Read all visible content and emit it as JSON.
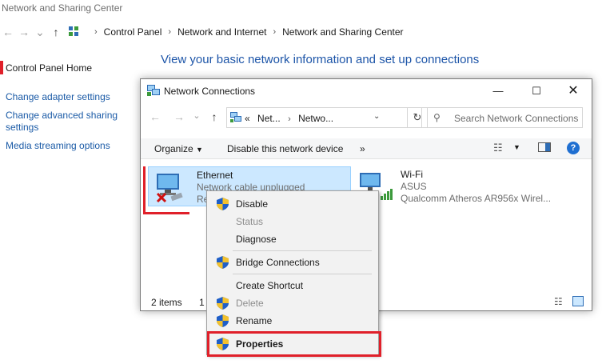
{
  "background_window": {
    "title": "Network and Sharing Center",
    "breadcrumb": [
      "Control Panel",
      "Network and Internet",
      "Network and Sharing Center"
    ],
    "sidebar": [
      "Control Panel Home",
      "Change adapter settings",
      "Change advanced sharing settings",
      "Media streaming options"
    ],
    "heading": "View your basic network information and set up connections"
  },
  "nc_window": {
    "title": "Network Connections",
    "address": {
      "prefix": "«",
      "crumbs": [
        "Net...",
        "Netwo..."
      ]
    },
    "search_placeholder": "Search Network Connections",
    "toolbar": {
      "organize": "Organize",
      "disable_device": "Disable this network device",
      "more": "»"
    },
    "adapters": [
      {
        "name": "Ethernet",
        "status": "Network cable unplugged",
        "device_partial": "Re"
      },
      {
        "name": "Wi-Fi",
        "status": "ASUS",
        "device": "Qualcomm Atheros AR956x Wirel..."
      }
    ],
    "status_bar": {
      "count": "2 items",
      "selected_partial": "1 i"
    }
  },
  "context_menu": {
    "items": [
      {
        "label": "Disable",
        "shield": true,
        "disabled": false,
        "bold": false
      },
      {
        "label": "Status",
        "shield": false,
        "disabled": true,
        "bold": false
      },
      {
        "label": "Diagnose",
        "shield": false,
        "disabled": false,
        "bold": false
      },
      {
        "label": "Bridge Connections",
        "shield": true,
        "disabled": false,
        "bold": false
      },
      {
        "label": "Create Shortcut",
        "shield": false,
        "disabled": false,
        "bold": false
      },
      {
        "label": "Delete",
        "shield": true,
        "disabled": true,
        "bold": false
      },
      {
        "label": "Rename",
        "shield": true,
        "disabled": false,
        "bold": false
      },
      {
        "label": "Properties",
        "shield": true,
        "disabled": false,
        "bold": true
      }
    ]
  },
  "colors": {
    "link": "#1a5aa6",
    "heading": "#1d55a8",
    "highlight_red": "#e0202a",
    "selection": "#cce8ff"
  },
  "icons": [
    "back-arrow-icon",
    "forward-arrow-icon",
    "up-arrow-icon",
    "network-center-icon",
    "network-connections-icon",
    "search-icon",
    "refresh-icon",
    "view-options-icon",
    "preview-pane-icon",
    "help-icon",
    "ethernet-adapter-icon",
    "disconnected-x-icon",
    "wifi-adapter-icon",
    "signal-bars-icon",
    "uac-shield-icon"
  ]
}
